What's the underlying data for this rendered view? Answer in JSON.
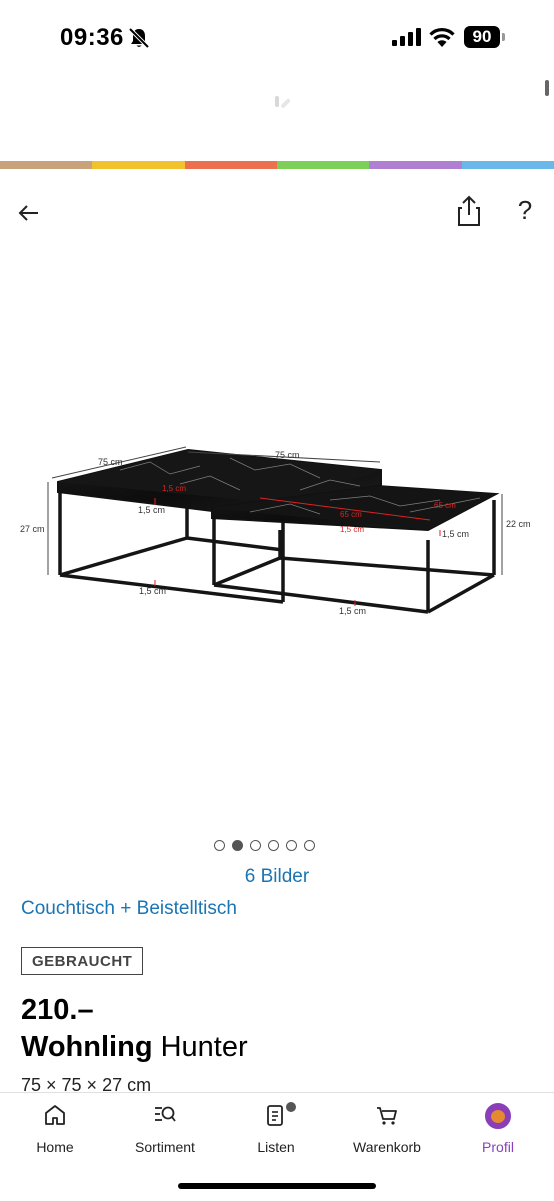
{
  "status_bar": {
    "time": "09:36",
    "battery": "90",
    "icons": [
      "bell-muted-icon",
      "signal-icon",
      "wifi-icon",
      "battery-icon"
    ]
  },
  "colors": {
    "stripe": [
      "#c8a27a",
      "#f2c12e",
      "#ec7050",
      "#7ccf57",
      "#b07fd2",
      "#6ab8ea"
    ],
    "link": "#1b74b3",
    "accent": "#8a3fb8"
  },
  "nav": {
    "icons": [
      "back-arrow-icon",
      "share-icon",
      "help-icon"
    ],
    "help_label": "?"
  },
  "product": {
    "image_labels": {
      "depth_left": "75 cm",
      "width_top": "75 cm",
      "height_left": "27 cm",
      "height_right": "22 cm",
      "frame_1": "1,5 cm",
      "frame_2": "1,5 cm",
      "frame_3": "1,5 cm",
      "frame_4": "1,5 cm",
      "frame_5": "1,5 cm",
      "frame_6": "1,5 cm",
      "small_1": "65 cm",
      "small_2": "65 cm"
    },
    "image_count_label": "6 Bilder",
    "carousel": {
      "total": 6,
      "active_index": 1
    },
    "category": "Couchtisch + Beistelltisch",
    "condition": "GEBRAUCHT",
    "price": "210.–",
    "brand": "Wohnling",
    "model": "Hunter",
    "dimensions": "75 × 75 × 27 cm"
  },
  "tabs": [
    {
      "label": "Home",
      "icon": "home-icon"
    },
    {
      "label": "Sortiment",
      "icon": "sortiment-search-icon"
    },
    {
      "label": "Listen",
      "icon": "list-icon"
    },
    {
      "label": "Warenkorb",
      "icon": "cart-icon"
    },
    {
      "label": "Profil",
      "icon": "avatar"
    }
  ]
}
